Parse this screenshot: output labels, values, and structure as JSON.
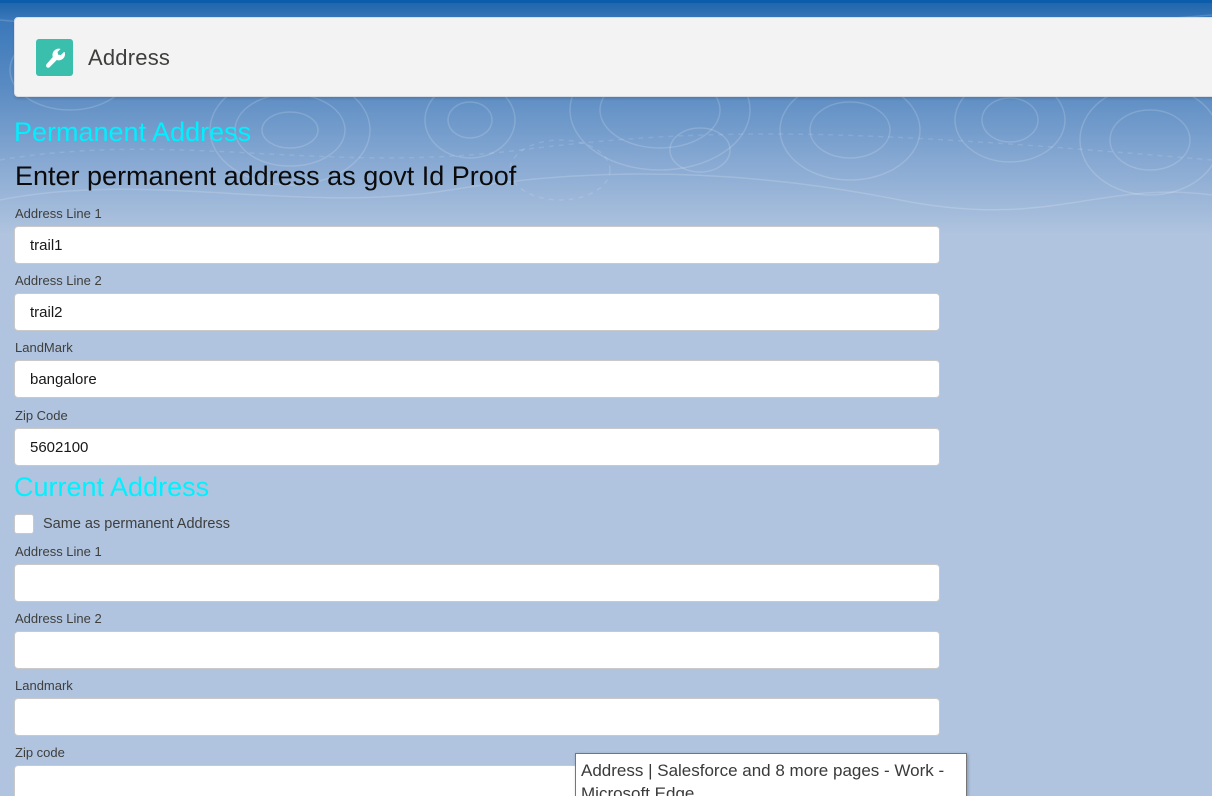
{
  "header": {
    "title": "Address",
    "icon": "wrench-icon",
    "icon_color": "#3bbfad"
  },
  "permanent": {
    "title": "Permanent Address",
    "subtitle": "Enter permanent address as govt Id Proof",
    "fields": [
      {
        "label": "Address Line 1",
        "value": "trail1"
      },
      {
        "label": "Address Line 2",
        "value": "trail2"
      },
      {
        "label": "LandMark",
        "value": "bangalore"
      },
      {
        "label": "Zip Code",
        "value": "5602100"
      }
    ]
  },
  "current": {
    "title": "Current Address",
    "same_as_label": "Same as permanent Address",
    "same_as_checked": false,
    "fields": [
      {
        "label": "Address Line 1",
        "value": ""
      },
      {
        "label": "Address Line 2",
        "value": ""
      },
      {
        "label": "Landmark",
        "value": ""
      },
      {
        "label": "Zip code",
        "value": ""
      }
    ]
  },
  "tooltip": {
    "line1": "Address | Salesforce and 8 more pages - Work -",
    "line2": "Microsoft Edge"
  },
  "colors": {
    "section_title": "#00f0ff",
    "background": "#b0c4df",
    "top_bar": "#0b5cab"
  }
}
